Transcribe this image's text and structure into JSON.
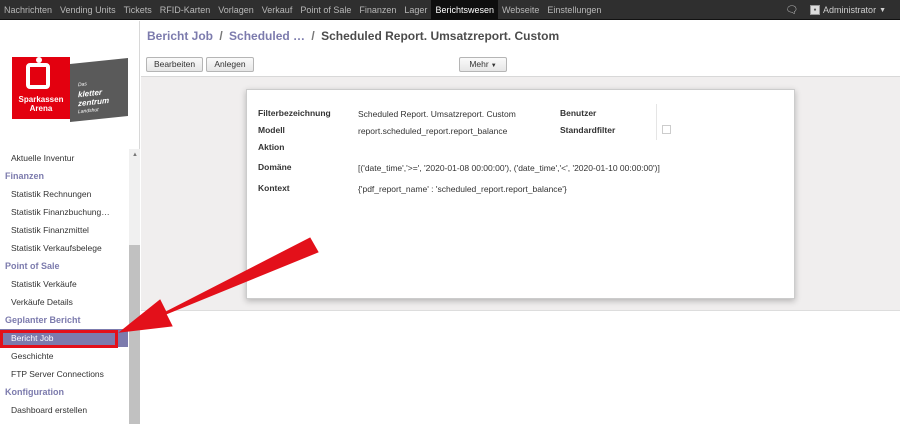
{
  "topbar": {
    "menu": [
      "Nachrichten",
      "Vending Units",
      "Tickets",
      "RFID-Karten",
      "Vorlagen",
      "Verkauf",
      "Point of Sale",
      "Finanzen",
      "Lager",
      "Berichtswesen",
      "Webseite",
      "Einstellungen"
    ],
    "active_menu": "Berichtswesen",
    "user_name": "Administrator",
    "icons": {
      "chat": "chat-bubbles-icon",
      "avatar": "user-avatar-icon",
      "caret": "caret-down-icon"
    }
  },
  "logo": {
    "brand_line1": "Sparkassen",
    "brand_line2": "Arena",
    "partner_small": "Das",
    "partner_line1": "kletter",
    "partner_line2": "zentrum",
    "partner_sub": "Landshut"
  },
  "sidebar": {
    "items": [
      {
        "type": "item",
        "label": "Aktuelle Inventur"
      },
      {
        "type": "section",
        "label": "Finanzen"
      },
      {
        "type": "item",
        "label": "Statistik Rechnungen"
      },
      {
        "type": "item",
        "label": "Statistik Finanzbuchung…"
      },
      {
        "type": "item",
        "label": "Statistik Finanzmittel"
      },
      {
        "type": "item",
        "label": "Statistik Verkaufsbelege"
      },
      {
        "type": "section",
        "label": "Point of Sale"
      },
      {
        "type": "item",
        "label": "Statistik Verkäufe"
      },
      {
        "type": "item",
        "label": "Verkäufe Details"
      },
      {
        "type": "section",
        "label": "Geplanter Bericht"
      },
      {
        "type": "item",
        "label": "Bericht Job",
        "active": true
      },
      {
        "type": "item",
        "label": "Geschichte"
      },
      {
        "type": "item",
        "label": "FTP Server Connections"
      },
      {
        "type": "section",
        "label": "Konfiguration"
      },
      {
        "type": "item",
        "label": "Dashboard erstellen"
      }
    ]
  },
  "breadcrumb": {
    "part1": "Bericht Job",
    "sep1": "/",
    "part2": "Scheduled …",
    "sep2": "/",
    "current": "Scheduled Report. Umsatzreport. Custom"
  },
  "toolbar": {
    "edit_label": "Bearbeiten",
    "create_label": "Anlegen",
    "more_label": "Mehr"
  },
  "form": {
    "filter_name_label": "Filterbezeichnung",
    "filter_name_value": "Scheduled Report. Umsatzreport. Custom",
    "model_label": "Modell",
    "model_value": "report.scheduled_report.report_balance",
    "action_label": "Aktion",
    "user_label": "Benutzer",
    "default_filter_label": "Standardfilter",
    "domain_label": "Domäne",
    "domain_value": "[('date_time','>=', '2020-01-08 00:00:00'), ('date_time','<', '2020-01-10 00:00:00')]",
    "context_label": "Kontext",
    "context_value": "{'pdf_report_name' : 'scheduled_report.report_balance'}"
  },
  "annotation": {
    "color": "#e3101a"
  }
}
